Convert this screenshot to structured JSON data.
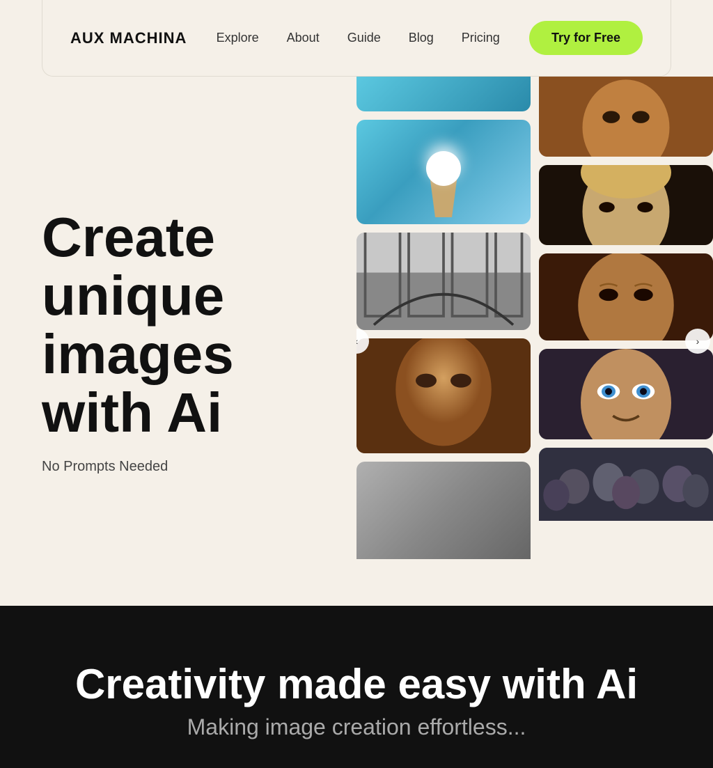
{
  "navbar": {
    "logo": "AUX MACHINA",
    "links": [
      {
        "id": "explore",
        "label": "Explore"
      },
      {
        "id": "about",
        "label": "About"
      },
      {
        "id": "guide",
        "label": "Guide"
      },
      {
        "id": "blog",
        "label": "Blog"
      },
      {
        "id": "pricing",
        "label": "Pricing"
      }
    ],
    "cta_label": "Try for Free"
  },
  "hero": {
    "title": "Create unique images with Ai",
    "subtitle": "No Prompts Needed"
  },
  "bottom": {
    "title": "Creativity made easy with Ai",
    "subtitle": "Making image creation effortless..."
  },
  "images": {
    "col1": [
      "icecream",
      "bridge",
      "man1",
      "object"
    ],
    "col2": [
      "man4",
      "man2",
      "man3",
      "crowd"
    ]
  },
  "carousel": {
    "left_arrow": "‹",
    "right_arrow": "›"
  }
}
